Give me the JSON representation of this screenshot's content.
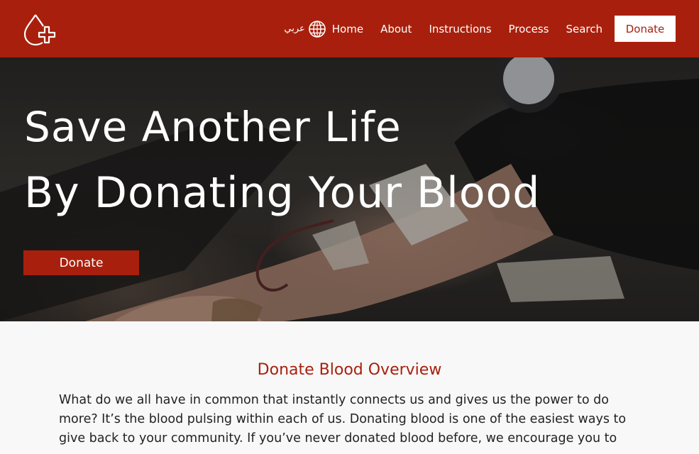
{
  "nav": {
    "language_label": "عربي",
    "links": [
      "Home",
      "About",
      "Instructions",
      "Process",
      "Search"
    ],
    "donate_label": "Donate"
  },
  "hero": {
    "line1": "Save Another Life",
    "line2": "By Donating Your Blood",
    "donate_label": "Donate"
  },
  "overview": {
    "title": "Donate Blood Overview",
    "text": "What do we all have in common that instantly connects us and gives us the power to do more? It’s the blood pulsing within each of us. Donating blood is one of the easiest ways to give back to your community. If you’ve never donated blood before, we encourage you to"
  },
  "colors": {
    "brand": "#a8200d",
    "text": "#222222",
    "background": "#f8f8f8"
  },
  "icons": {
    "logo": "blood-drop-plus-icon",
    "language": "globe-icon"
  }
}
